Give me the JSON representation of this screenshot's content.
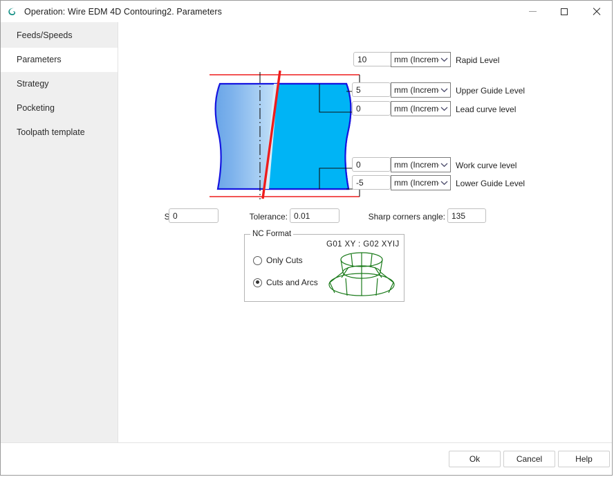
{
  "window": {
    "title": "Operation: Wire EDM 4D Contouring2. Parameters",
    "app_icon": "spiral-s-logo",
    "minimize_label": "Minimize",
    "maximize_label": "Maximize",
    "close_label": "Close"
  },
  "sidebar": {
    "items": [
      {
        "label": "Feeds/Speeds",
        "selected": false
      },
      {
        "label": "Parameters",
        "selected": true
      },
      {
        "label": "Strategy",
        "selected": false
      },
      {
        "label": "Pocketing",
        "selected": false
      },
      {
        "label": "Toolpath template",
        "selected": false
      }
    ]
  },
  "levels": [
    {
      "value": "10",
      "unit": "mm (Increme",
      "label": "Rapid Level"
    },
    {
      "value": "5",
      "unit": "mm (Increme",
      "label": "Upper Guide Level"
    },
    {
      "value": "0",
      "unit": "mm (Increme",
      "label": "Lead curve level"
    },
    {
      "value": "0",
      "unit": "mm (Increme",
      "label": "Work curve level"
    },
    {
      "value": "-5",
      "unit": "mm (Increme",
      "label": "Lower Guide Level"
    }
  ],
  "params": {
    "stock_label": "Stock:",
    "stock_value": "0",
    "tolerance_label": "Tolerance:",
    "tolerance_value": "0.01",
    "sharp_corners_label": "Sharp corners angle:",
    "sharp_corners_value": "135"
  },
  "nc_format": {
    "group_title": "NC Format",
    "code_label": "G01 XY : G02 XYIJ",
    "options": [
      {
        "label": "Only Cuts",
        "selected": false
      },
      {
        "label": "Cuts and Arcs",
        "selected": true
      }
    ]
  },
  "footer": {
    "ok_label": "Ok",
    "cancel_label": "Cancel",
    "help_label": "Help"
  },
  "colors": {
    "wire_red": "#ee1c1c",
    "part_outline_blue": "#1414e0",
    "cyan_fill": "#00b4f5",
    "sidebar_bg": "#efefef",
    "cone_green": "#1a7a1a",
    "accent_teal": "#18a79a"
  }
}
